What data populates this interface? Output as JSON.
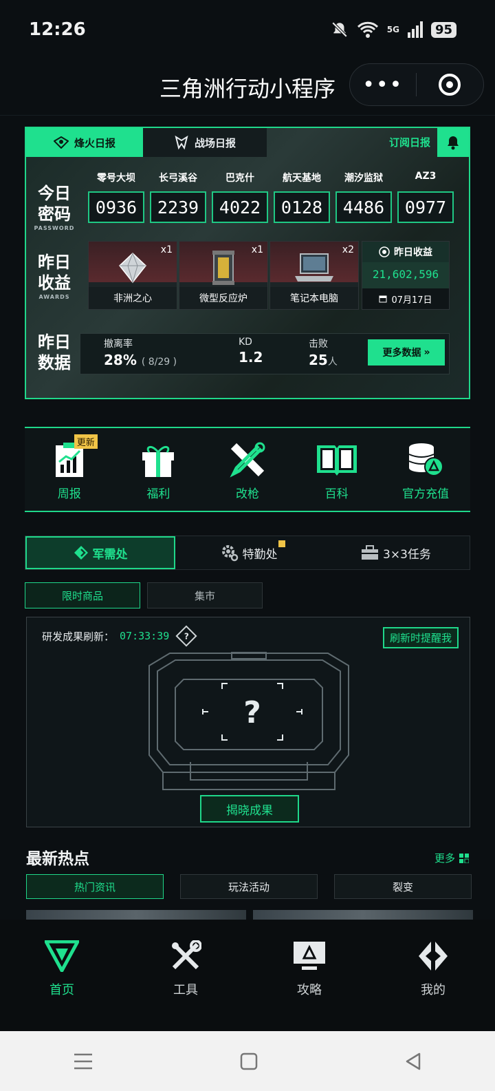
{
  "status": {
    "time": "12:26",
    "battery": "95",
    "network": "5G"
  },
  "app": {
    "title": "三角洲行动小程序",
    "more_label": "•••"
  },
  "report": {
    "tabs": [
      {
        "label": "烽火日报"
      },
      {
        "label": "战场日报"
      }
    ],
    "subscribe_label": "订阅日报",
    "password_label": {
      "title_line1": "今日",
      "title_line2": "密码",
      "sub": "PASSWORD"
    },
    "awards_label": {
      "title_line1": "昨日",
      "title_line2": "收益",
      "sub": "AWARDS"
    },
    "data_label": {
      "title_line1": "昨日",
      "title_line2": "数据"
    },
    "codes": [
      {
        "map": "零号大坝",
        "code": "0936"
      },
      {
        "map": "长弓溪谷",
        "code": "2239"
      },
      {
        "map": "巴克什",
        "code": "4022"
      },
      {
        "map": "航天基地",
        "code": "0128"
      },
      {
        "map": "潮汐监狱",
        "code": "4486"
      },
      {
        "map": "AZ3",
        "code": "0977"
      }
    ],
    "awards": [
      {
        "name": "非洲之心",
        "qty": "x1"
      },
      {
        "name": "微型反应炉",
        "qty": "x1"
      },
      {
        "name": "笔记本电脑",
        "qty": "x2"
      }
    ],
    "income": {
      "title": "昨日收益",
      "amount": "21,602,596",
      "date": "07月17日"
    },
    "stats": {
      "extract_label": "撤离率",
      "extract_value": "28%",
      "extract_detail": "( 8/29 )",
      "kd_label": "KD",
      "kd_value": "1.2",
      "kill_label": "击败",
      "kill_value": "25",
      "kill_unit": "人",
      "more_label": "更多数据"
    }
  },
  "quick": [
    {
      "label": "周报",
      "badge": "更新"
    },
    {
      "label": "福利"
    },
    {
      "label": "改枪"
    },
    {
      "label": "百科"
    },
    {
      "label": "官方充值"
    }
  ],
  "sections": [
    {
      "label": "军需处"
    },
    {
      "label": "特勤处"
    },
    {
      "label": "3×3任务"
    }
  ],
  "sub_tabs": [
    {
      "label": "限时商品"
    },
    {
      "label": "集市"
    }
  ],
  "research": {
    "refresh_label": "研发成果刷新：",
    "countdown": "07:33:39",
    "help_label": "?",
    "remind_label": "刷新时提醒我",
    "reveal_label": "揭晓成果"
  },
  "hot": {
    "title": "最新热点",
    "more_label": "更多",
    "tabs": [
      {
        "label": "热门资讯"
      },
      {
        "label": "玩法活动"
      },
      {
        "label": "裂变"
      }
    ]
  },
  "bottom_nav": [
    {
      "label": "首页"
    },
    {
      "label": "工具"
    },
    {
      "label": "攻略"
    },
    {
      "label": "我的"
    }
  ],
  "colors": {
    "accent": "#1fe08e",
    "background": "#0b0f12",
    "badge": "#f0c447"
  }
}
